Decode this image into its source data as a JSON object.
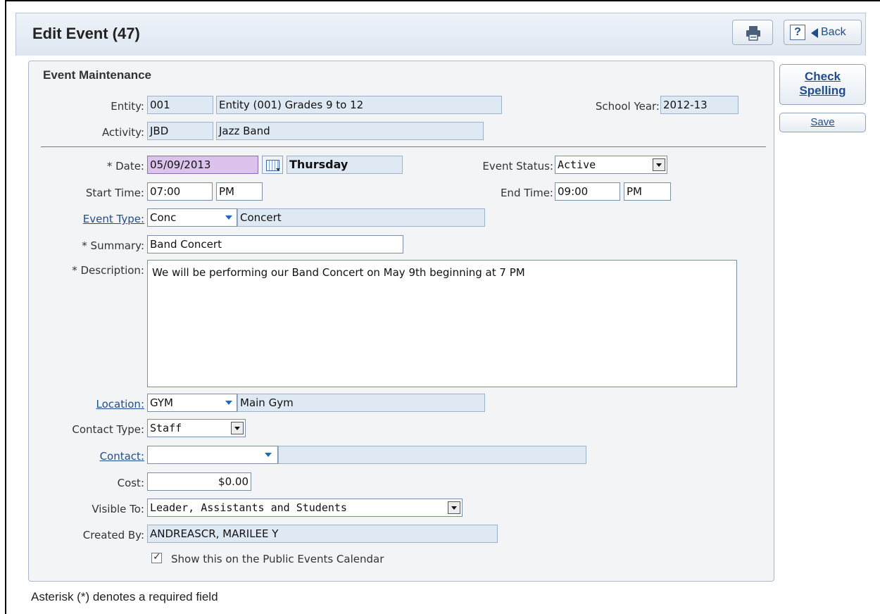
{
  "header": {
    "title": "Edit Event (47)",
    "print_icon": "printer-icon",
    "help_label": "?",
    "back_label": "Back"
  },
  "side_buttons": {
    "check_line1": "Check",
    "check_line2": "Spelling",
    "save_label": "Save"
  },
  "form": {
    "section_title": "Event Maintenance",
    "entity": {
      "label": "Entity:",
      "code": "001",
      "name": "Entity (001) Grades 9 to 12"
    },
    "school_year": {
      "label": "School Year:",
      "value": "2012-13"
    },
    "activity": {
      "label": "Activity:",
      "code": "JBD",
      "name": "Jazz Band"
    },
    "date": {
      "label": "* Date:",
      "value": "05/09/2013",
      "day": "Thursday"
    },
    "event_status": {
      "label": "Event Status:",
      "value": "Active"
    },
    "start_time": {
      "label": "Start Time:",
      "time": "07:00",
      "ampm": "PM"
    },
    "end_time": {
      "label": "End Time:",
      "time": "09:00",
      "ampm": "PM"
    },
    "event_type": {
      "label": "Event Type:",
      "code": "Conc",
      "name": "Concert"
    },
    "summary": {
      "label": "* Summary:",
      "value": "Band Concert"
    },
    "description": {
      "label": "* Description:",
      "value": "We will be performing our Band Concert on May 9th beginning at 7 PM"
    },
    "location": {
      "label": "Location:",
      "code": "GYM",
      "name": "Main Gym"
    },
    "contact_type": {
      "label": "Contact Type:",
      "value": "Staff"
    },
    "contact": {
      "label": "Contact:",
      "code": "",
      "name": ""
    },
    "cost": {
      "label": "Cost:",
      "value": "$0.00"
    },
    "visible_to": {
      "label": "Visible To:",
      "value": "Leader, Assistants and Students"
    },
    "created_by": {
      "label": "Created By:",
      "value": "ANDREASCR, MARILEE Y"
    },
    "public_calendar": {
      "label": "Show this on the Public Events Calendar",
      "checked": true
    }
  },
  "footnote": "Asterisk (*) denotes a required field"
}
